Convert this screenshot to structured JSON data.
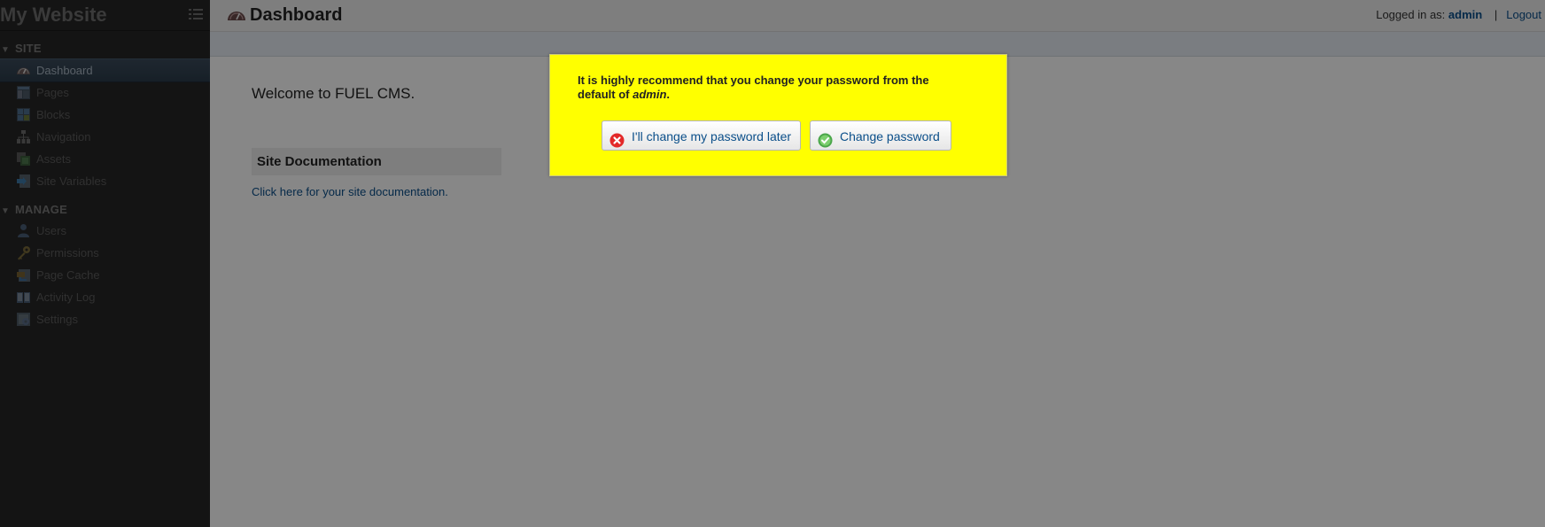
{
  "sidebar": {
    "site_title": "My Website",
    "sections": [
      {
        "label": "SITE"
      },
      {
        "label": "MANAGE"
      }
    ],
    "items": [
      {
        "label": "Dashboard",
        "icon": "dashboard-icon"
      },
      {
        "label": "Pages",
        "icon": "pages-icon"
      },
      {
        "label": "Blocks",
        "icon": "blocks-icon"
      },
      {
        "label": "Navigation",
        "icon": "navigation-icon"
      },
      {
        "label": "Assets",
        "icon": "assets-icon"
      },
      {
        "label": "Site Variables",
        "icon": "site-variables-icon"
      },
      {
        "label": "Users",
        "icon": "users-icon"
      },
      {
        "label": "Permissions",
        "icon": "key-icon"
      },
      {
        "label": "Page Cache",
        "icon": "page-cache-icon"
      },
      {
        "label": "Activity Log",
        "icon": "book-icon"
      },
      {
        "label": "Settings",
        "icon": "settings-icon"
      }
    ]
  },
  "header": {
    "title": "Dashboard",
    "logged_in_label": "Logged in as:",
    "username": "admin",
    "separator": "|",
    "logout": "Logout"
  },
  "main": {
    "welcome": "Welcome to FUEL CMS.",
    "doc_heading": "Site Documentation",
    "doc_link": "Click here for your site documentation."
  },
  "modal": {
    "message_prefix": "It is highly recommend that you change your password from the default of",
    "message_em": "admin",
    "message_suffix": ".",
    "later_button": "I'll change my password later",
    "change_button": "Change password"
  },
  "colors": {
    "modal_bg": "#ffff00",
    "link": "#0b4f8a",
    "sidebar_bg": "#262626"
  }
}
